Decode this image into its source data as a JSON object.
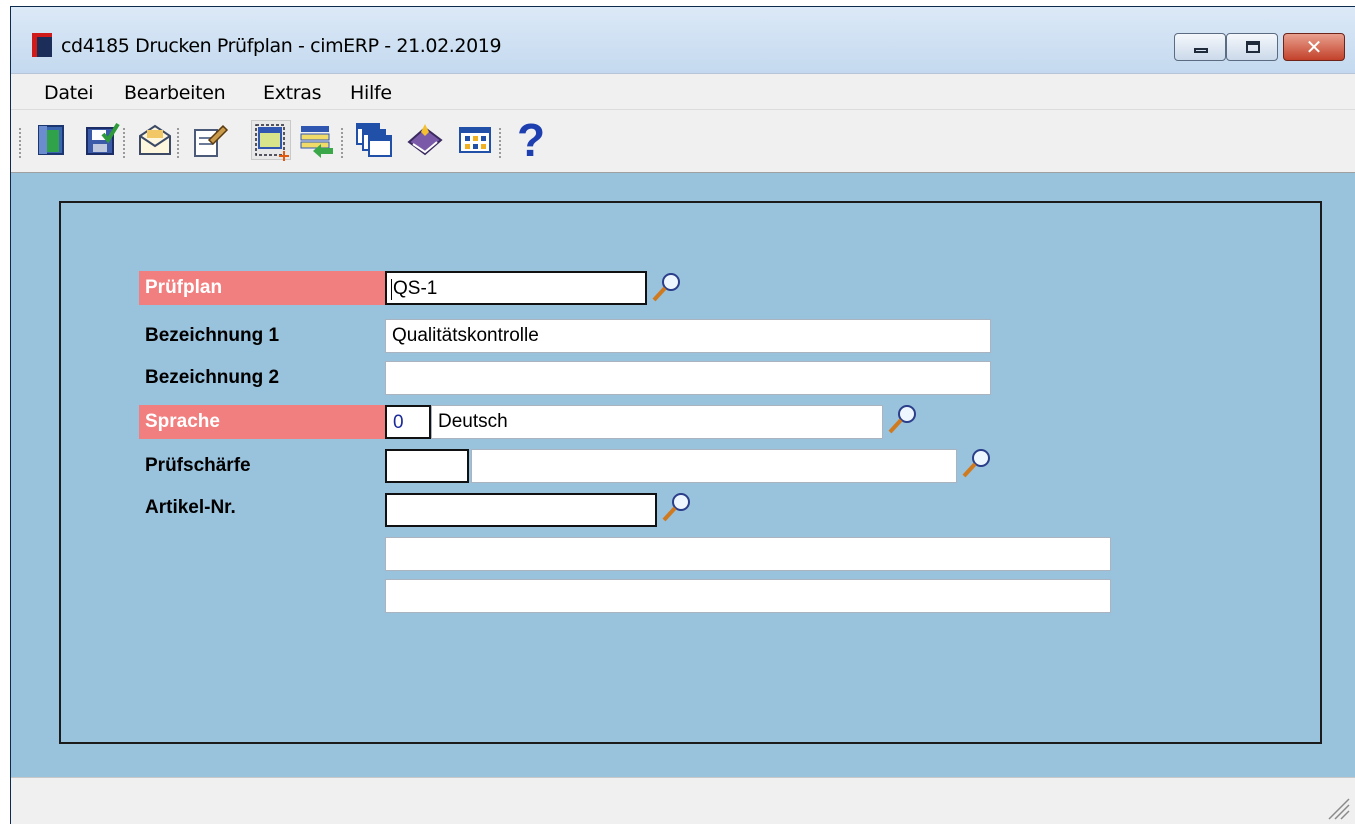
{
  "window": {
    "title": "cd4185 Drucken Prüfplan - cimERP - 21.02.2019",
    "controls": [
      "minimize",
      "maximize",
      "close"
    ]
  },
  "menu": {
    "items": [
      "Datei",
      "Bearbeiten",
      "Extras",
      "Hilfe"
    ]
  },
  "toolbar": {
    "buttons": [
      {
        "icon": "exit-door-icon"
      },
      {
        "icon": "save-check-icon"
      },
      {
        "icon": "mail-envelope-icon"
      },
      {
        "icon": "edit-document-icon"
      },
      {
        "icon": "new-selection-icon"
      },
      {
        "icon": "transfer-list-icon"
      },
      {
        "icon": "windows-icon"
      },
      {
        "icon": "book-icon"
      },
      {
        "icon": "grid-table-icon"
      },
      {
        "icon": "help-icon",
        "label": "?"
      }
    ]
  },
  "form": {
    "pruefplan": {
      "label": "Prüfplan",
      "value": "QS-1",
      "required": true
    },
    "bezeichnung1": {
      "label": "Bezeichnung 1",
      "value": "Qualitätskontrolle"
    },
    "bezeichnung2": {
      "label": "Bezeichnung 2",
      "value": ""
    },
    "sprache": {
      "label": "Sprache",
      "code": "0",
      "name": "Deutsch",
      "required": true
    },
    "pruefschaerfe": {
      "label": "Prüfschärfe",
      "code": "",
      "name": ""
    },
    "artikel": {
      "label": "Artikel-Nr.",
      "value": "",
      "line1": "",
      "line2": ""
    }
  },
  "colors": {
    "required_label_bg": "#f27f7f",
    "client_bg": "#99c2dc",
    "frame_border": "#1b1b1b"
  },
  "statusbar": {
    "text": ""
  }
}
